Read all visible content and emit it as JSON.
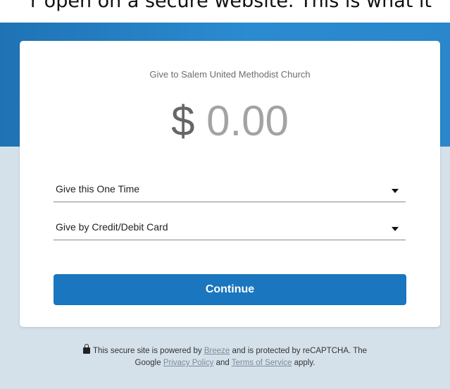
{
  "caption": "r open on a secure website. This is what it",
  "card": {
    "org_title": "Give to Salem United Methodist Church",
    "currency_symbol": "$",
    "amount": "0.00",
    "frequency_select": "Give this One Time",
    "payment_select": "Give by Credit/Debit Card",
    "continue_label": "Continue"
  },
  "footer": {
    "lock_icon": "lock-icon",
    "text1": "This secure site is powered by",
    "link_breeze": "Breeze",
    "text2": "and is protected by reCAPTCHA. The",
    "text3": "Google",
    "link_privacy": "Privacy Policy",
    "text4": "and",
    "link_terms": "Terms of Service",
    "text5": "apply."
  },
  "colors": {
    "header_blue": "#2383c6",
    "button_blue": "#1a76be",
    "page_bg": "#d5e1ea"
  }
}
